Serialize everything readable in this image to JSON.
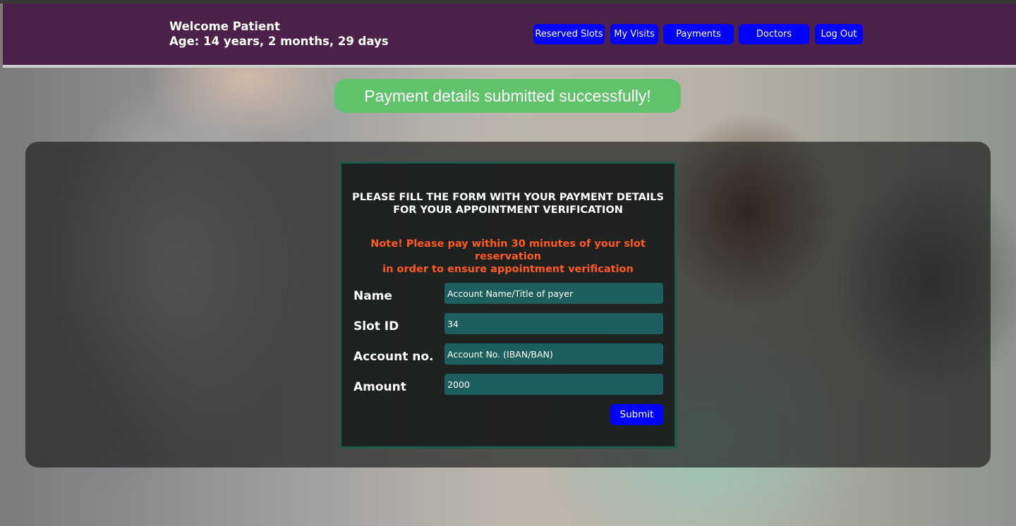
{
  "header": {
    "welcome": "Welcome Patient",
    "age": "Age: 14 years, 2 months, 29 days"
  },
  "nav": {
    "reserved_slots": "Reserved Slots",
    "my_visits": "My Visits",
    "payments": "Payments",
    "doctors": "Doctors",
    "log_out": "Log Out"
  },
  "alert": {
    "message": "Payment details submitted successfully!"
  },
  "form": {
    "title_line1": "PLEASE FILL THE FORM WITH YOUR PAYMENT DETAILS",
    "title_line2": "FOR YOUR APPOINTMENT VERIFICATION",
    "note_line1": "Note! Please pay within 30 minutes of your slot reservation",
    "note_line2": "in order to ensure appointment verification",
    "fields": {
      "name": {
        "label": "Name",
        "value": "",
        "placeholder": "Account Name/Title of payer"
      },
      "slot_id": {
        "label": "Slot ID",
        "value": "34",
        "placeholder": ""
      },
      "account_no": {
        "label": "Account no.",
        "value": "",
        "placeholder": "Account No. (IBAN/BAN)"
      },
      "amount": {
        "label": "Amount",
        "value": "2000",
        "placeholder": ""
      }
    },
    "submit_label": "Submit"
  },
  "colors": {
    "navbar": "#4c2149",
    "button": "#0000ff",
    "alert": "#61c26c",
    "note": "#ff5a1f",
    "input": "#1d5f5f",
    "form_border": "#1a5d4a"
  }
}
